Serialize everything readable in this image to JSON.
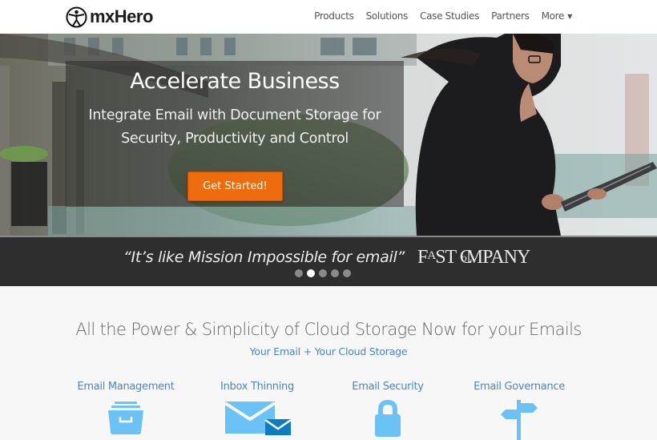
{
  "header": {
    "logo_text": "mxHero",
    "nav": [
      {
        "label": "Products"
      },
      {
        "label": "Solutions"
      },
      {
        "label": "Case Studies"
      },
      {
        "label": "Partners"
      },
      {
        "label": "More",
        "has_dropdown": true
      }
    ]
  },
  "hero": {
    "title": "Accelerate Business",
    "subtitle_line1": "Integrate Email with Document Storage for",
    "subtitle_line2": "Security, Productivity and Control",
    "cta_label": "Get Started!",
    "cta_color": "#ee6c0d"
  },
  "testimonial": {
    "quote": "“It’s like Mission Impossible for email”",
    "source": "FAST COMPANY",
    "source_display": "FᴬST C©MPANY",
    "slides": 5,
    "active_slide": 2
  },
  "features": {
    "title": "All the Power & Simplicity of Cloud Storage Now for your Emails",
    "subtitle": "Your Email + Your Cloud Storage",
    "accent_color": "#4a86c5",
    "icon_color": "#6ac2f7",
    "items": [
      {
        "label": "Email Management",
        "icon": "file-cabinet-icon"
      },
      {
        "label": "Inbox Thinning",
        "icon": "envelope-icon"
      },
      {
        "label": "Email Security",
        "icon": "lock-icon"
      },
      {
        "label": "Email Governance",
        "icon": "signpost-icon"
      }
    ]
  }
}
